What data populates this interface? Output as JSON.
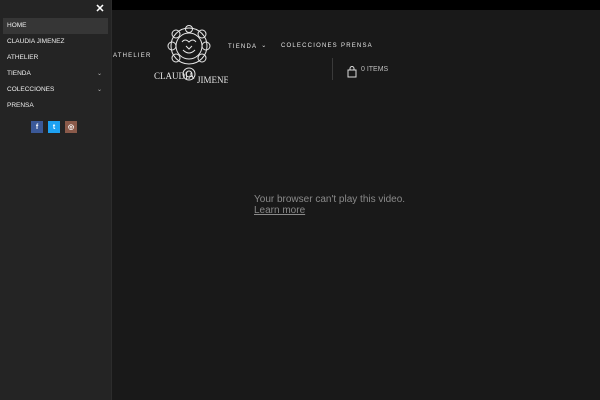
{
  "sidebar": {
    "close_glyph": "✕",
    "items": [
      {
        "label": "HOME",
        "active": true
      },
      {
        "label": "CLAUDIA JIMENEZ"
      },
      {
        "label": "ATHELIER"
      },
      {
        "label": "TIENDA",
        "has_submenu": true
      },
      {
        "label": "COLECCIONES",
        "has_submenu": true
      },
      {
        "label": "PRENSA"
      }
    ],
    "social": [
      {
        "icon": "facebook-icon",
        "glyph": "f",
        "color": "#3b5998"
      },
      {
        "icon": "twitter-icon",
        "glyph": "t",
        "color": "#1da1f2"
      },
      {
        "icon": "instagram-icon",
        "glyph": "◎",
        "color": "#8a5a4a"
      }
    ]
  },
  "header": {
    "nav": {
      "athelier": "ATHELIER",
      "tienda": "TIENDA",
      "colecciones": "COLECCIONES",
      "prensa": "PRENSA"
    },
    "logo_text_left": "CLAUDIA",
    "logo_text_right": "JIMENEZ",
    "cart_label": "0 ITEMS"
  },
  "video": {
    "message": "Your browser can't play this video.",
    "link": "Learn more"
  }
}
